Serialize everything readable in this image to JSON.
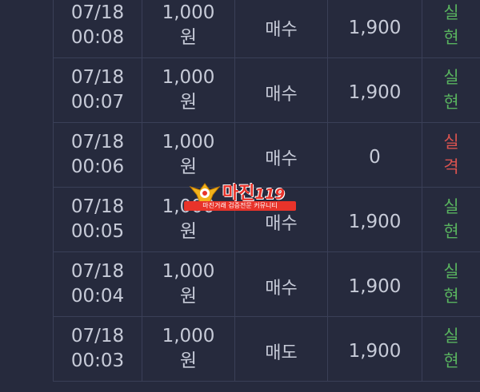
{
  "rows": [
    {
      "date": "07/18",
      "time": "00:08",
      "amount": "1,000",
      "unit": "원",
      "type": "매수",
      "value": "1,900",
      "result": [
        "실",
        "현"
      ],
      "status": "success"
    },
    {
      "date": "07/18",
      "time": "00:07",
      "amount": "1,000",
      "unit": "원",
      "type": "매수",
      "value": "1,900",
      "result": [
        "실",
        "현"
      ],
      "status": "success"
    },
    {
      "date": "07/18",
      "time": "00:06",
      "amount": "1,000",
      "unit": "원",
      "type": "매수",
      "value": "0",
      "result": [
        "실",
        "격"
      ],
      "status": "fail"
    },
    {
      "date": "07/18",
      "time": "00:05",
      "amount": "1,000",
      "unit": "원",
      "type": "매수",
      "value": "1,900",
      "result": [
        "실",
        "현"
      ],
      "status": "success"
    },
    {
      "date": "07/18",
      "time": "00:04",
      "amount": "1,000",
      "unit": "원",
      "type": "매수",
      "value": "1,900",
      "result": [
        "실",
        "현"
      ],
      "status": "success"
    },
    {
      "date": "07/18",
      "time": "00:03",
      "amount": "1,000",
      "unit": "원",
      "type": "매도",
      "value": "1,900",
      "result": [
        "실",
        "현"
      ],
      "status": "success"
    }
  ],
  "watermark": {
    "title": "마진",
    "number": "119",
    "tagline": "마진거래 검증전문 커뮤니티"
  },
  "colors": {
    "background": "#262a3d",
    "text": "#c7cbd8",
    "success": "#59b35f",
    "fail": "#d9534f",
    "brand": "#e8332a"
  }
}
